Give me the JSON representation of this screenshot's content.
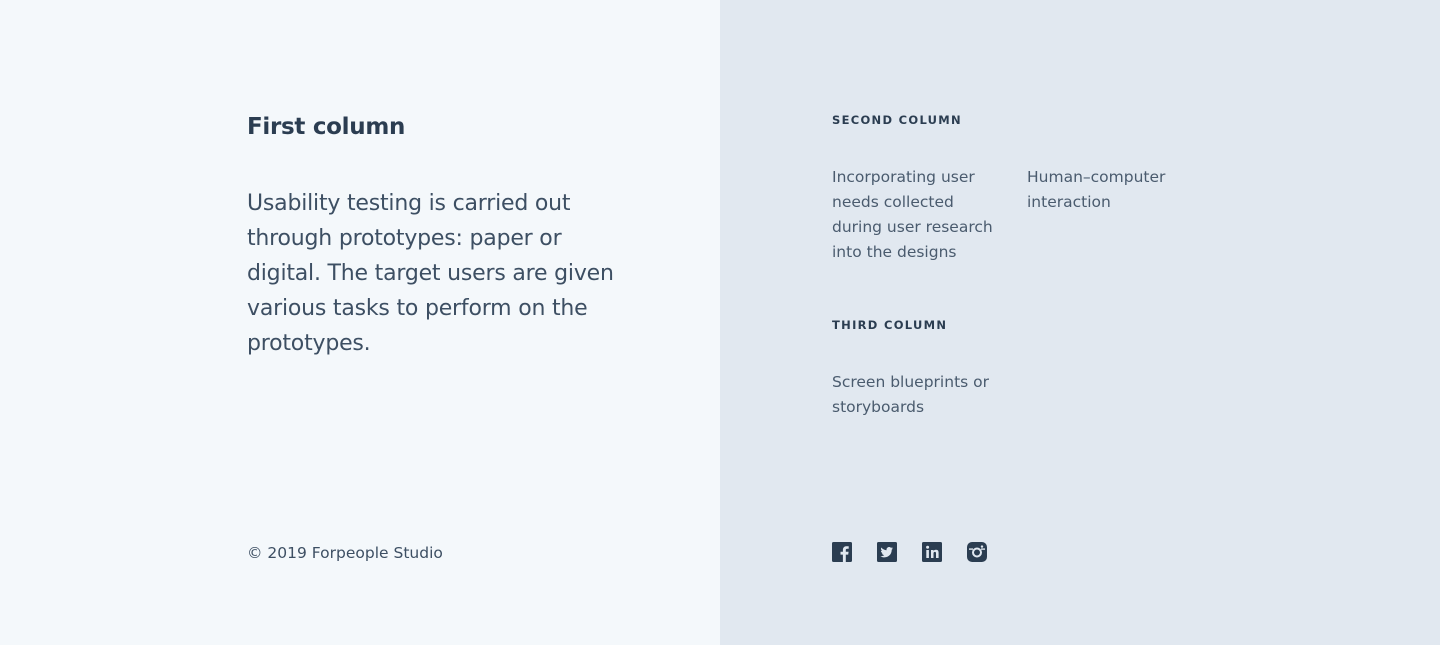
{
  "first_column": {
    "title": "First column",
    "body": "Usability testing is carried out through prototypes: paper or digital. The target users are given various tasks to perform on the prototypes.",
    "copyright": "© 2019 Forpeople Studio"
  },
  "second_column": {
    "heading": "SECOND COLUMN",
    "items": [
      "Incorporating user needs collected during user research into the designs",
      "Human–computer interaction"
    ]
  },
  "third_column": {
    "heading": "THIRD COLUMN",
    "items": [
      "Screen blueprints or storyboards"
    ]
  },
  "social_icons": [
    "facebook-icon",
    "twitter-icon",
    "linkedin-icon",
    "instagram-icon"
  ],
  "colors": {
    "left_background": "#f4f8fb",
    "right_background": "#e1e8f0",
    "text": "#3d4f63",
    "heading": "#2b3d51"
  }
}
